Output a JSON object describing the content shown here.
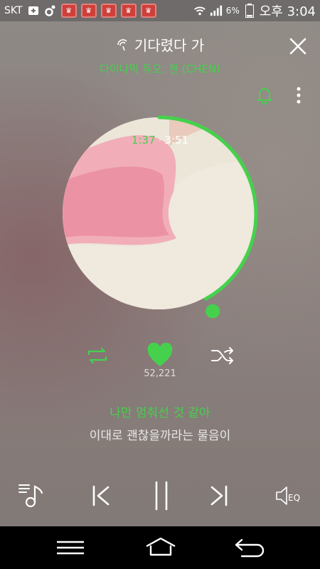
{
  "status_bar": {
    "carrier": "SKT",
    "battery_percent": "6%",
    "time": "오후 3:04"
  },
  "header": {
    "song_title": "기다렸다 가",
    "artist": "다이나믹 듀오, 첸 (CHEN)"
  },
  "player": {
    "elapsed": "1:37",
    "separator": "·",
    "total": "3:51",
    "progress": 0.42,
    "like_count": "52,221"
  },
  "lyrics": {
    "current": "나만 멈춰선 것 같아",
    "next": "이대로 괜찮을까라는 물음이"
  },
  "controls": {
    "eq_label": "EQ"
  },
  "colors": {
    "accent": "#45d14c",
    "background": "#8a807d",
    "navbar": "#000000"
  }
}
